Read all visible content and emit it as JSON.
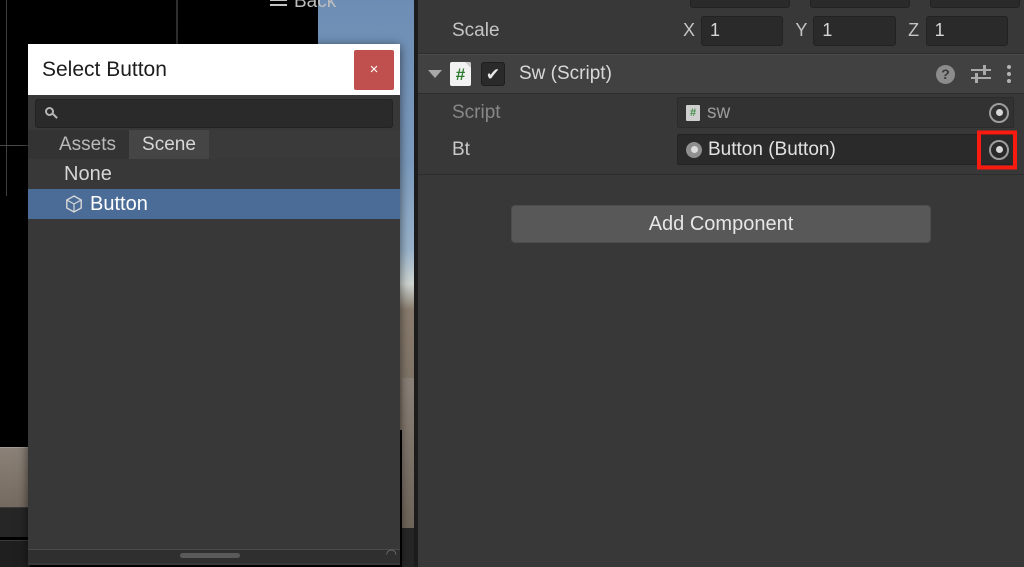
{
  "scene_view": {
    "back_label": "Back",
    "menu_icon": "hamburger-icon"
  },
  "inspector": {
    "transform": {
      "scale_label": "Scale",
      "axes": [
        {
          "axis": "X",
          "value": "1"
        },
        {
          "axis": "Y",
          "value": "1"
        },
        {
          "axis": "Z",
          "value": "1"
        }
      ]
    },
    "component": {
      "title": "Sw (Script)",
      "enabled": true,
      "checkbox_glyph": "✔",
      "script_icon_glyph": "#",
      "foldout_expanded": true,
      "tools": {
        "help_glyph": "?",
        "help_name": "help-icon",
        "preset_name": "preset-icon",
        "menu_name": "kebab-menu-icon"
      },
      "properties": [
        {
          "label": "Script",
          "value": "sw",
          "icon": "script-asset-icon",
          "readonly": true,
          "highlighted": false
        },
        {
          "label": "Bt",
          "value": "Button (Button)",
          "icon": "object-reference-icon",
          "readonly": false,
          "highlighted": true
        }
      ]
    },
    "add_component_label": "Add Component"
  },
  "picker_dialog": {
    "title": "Select Button",
    "close_label": "×",
    "search": {
      "value": "",
      "placeholder": ""
    },
    "tabs": [
      {
        "label": "Assets",
        "active": false
      },
      {
        "label": "Scene",
        "active": true
      }
    ],
    "items": [
      {
        "label": "None",
        "icon": "none",
        "selected": false
      },
      {
        "label": "Button",
        "icon": "cube-icon",
        "selected": true
      }
    ]
  },
  "colors": {
    "accent_selection": "#4a6c96",
    "highlight_red": "#f91a10",
    "close_red": "#c0504d",
    "panel_bg": "#383838",
    "field_bg": "#2a2a2a",
    "title_bg": "#ffffff"
  }
}
